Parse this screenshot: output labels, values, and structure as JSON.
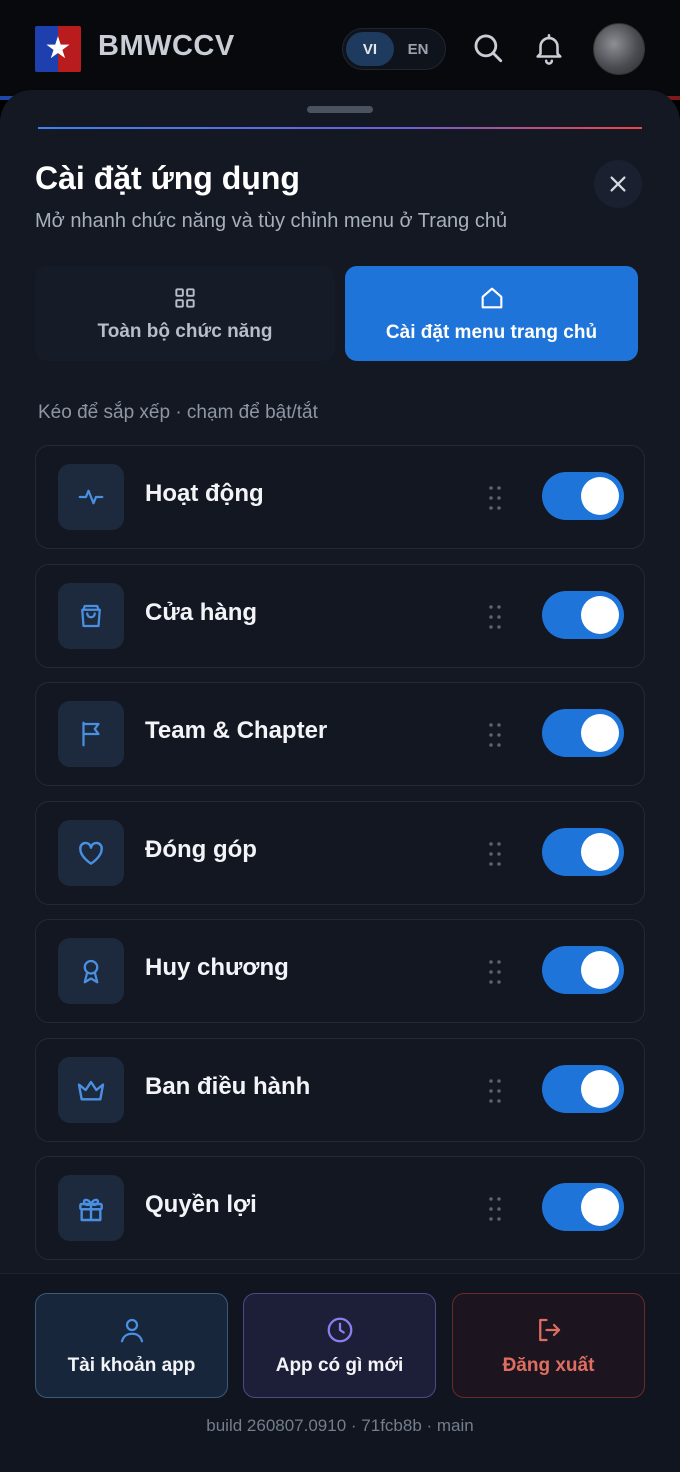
{
  "header": {
    "brand": "BMWCCV",
    "lang_options": [
      "VI",
      "EN"
    ],
    "lang_selected": "VI",
    "icons": [
      "search-icon",
      "bell-icon"
    ]
  },
  "sheet": {
    "title": "Cài đặt ứng dụng",
    "subtitle": "Mở nhanh chức năng và tùy chỉnh menu ở Trang chủ",
    "tabs": [
      {
        "label": "Toàn bộ chức năng",
        "icon": "grid-icon",
        "active": false
      },
      {
        "label": "Cài đặt menu trang chủ",
        "icon": "home-icon",
        "active": true
      }
    ],
    "hint": "Kéo để sắp xếp · chạm để bật/tắt",
    "items": [
      {
        "label": "Hoạt động",
        "icon": "activity-icon",
        "enabled": true
      },
      {
        "label": "Cửa hàng",
        "icon": "shopping-bag-icon",
        "enabled": true
      },
      {
        "label": "Team & Chapter",
        "icon": "flag-icon",
        "enabled": true
      },
      {
        "label": "Đóng góp",
        "icon": "heart-icon",
        "enabled": true
      },
      {
        "label": "Huy chương",
        "icon": "medal-icon",
        "enabled": true
      },
      {
        "label": "Ban điều hành",
        "icon": "crown-icon",
        "enabled": true
      },
      {
        "label": "Quyền lợi",
        "icon": "gift-icon",
        "enabled": true
      }
    ]
  },
  "footer": {
    "account_label": "Tài khoản app",
    "whats_new_label": "App có gì mới",
    "logout_label": "Đăng xuất",
    "build": "build 260807.0910 · 71fcb8b · main"
  },
  "colors": {
    "accent": "#1f74d9",
    "logout": "#e06e60",
    "sheet_bg": "#131823"
  }
}
